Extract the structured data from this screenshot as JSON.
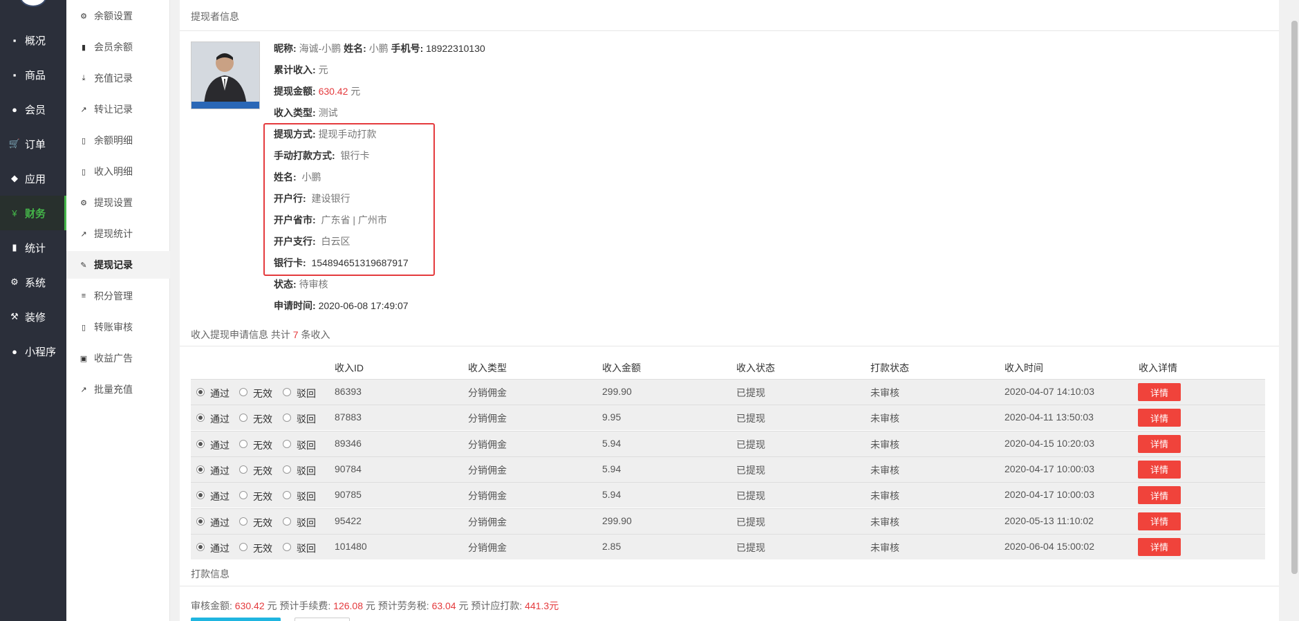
{
  "nav": {
    "items": [
      {
        "label": "概况",
        "icon": "dashboard-icon"
      },
      {
        "label": "商品",
        "icon": "box-icon"
      },
      {
        "label": "会员",
        "icon": "users-icon"
      },
      {
        "label": "订单",
        "icon": "cart-icon"
      },
      {
        "label": "应用",
        "icon": "cubes-icon"
      },
      {
        "label": "财务",
        "icon": "yen-icon",
        "active": true
      },
      {
        "label": "统计",
        "icon": "bar-chart-icon"
      },
      {
        "label": "系统",
        "icon": "gears-icon"
      },
      {
        "label": "装修",
        "icon": "gavel-icon"
      },
      {
        "label": "小程序",
        "icon": "wechat-icon"
      }
    ]
  },
  "subnav": {
    "items": [
      {
        "label": "余额设置",
        "icon": "gear-icon"
      },
      {
        "label": "会员余额",
        "icon": "book-icon"
      },
      {
        "label": "充值记录",
        "icon": "download-icon"
      },
      {
        "label": "转让记录",
        "icon": "external-link-icon"
      },
      {
        "label": "余额明细",
        "icon": "file-icon"
      },
      {
        "label": "收入明细",
        "icon": "file-icon"
      },
      {
        "label": "提现设置",
        "icon": "gear-icon"
      },
      {
        "label": "提现统计",
        "icon": "line-chart-icon"
      },
      {
        "label": "提现记录",
        "icon": "pencil-icon",
        "active": true
      },
      {
        "label": "积分管理",
        "icon": "database-icon"
      },
      {
        "label": "转账审核",
        "icon": "file-icon"
      },
      {
        "label": "收益广告",
        "icon": "image-icon"
      },
      {
        "label": "批量充值",
        "icon": "line-chart-icon"
      }
    ]
  },
  "applicant": {
    "section_title": "提现者信息",
    "nickname_label": "昵称:",
    "nickname": "海诚-小鹏",
    "name_label": "姓名:",
    "name": "小鹏",
    "phone_label": "手机号:",
    "phone": "18922310130",
    "total_income_label": "累计收入:",
    "total_income_unit": "元",
    "amount_label": "提现金额:",
    "amount": "630.42",
    "amount_unit": "元",
    "income_type_label": "收入类型:",
    "income_type": "测试",
    "method_label": "提现方式:",
    "method": "提现手动打款",
    "manual_method_label": "手动打款方式:",
    "manual_method": "银行卡",
    "holder_label": "姓名:",
    "holder": "小鹏",
    "bank_label": "开户行:",
    "bank": "建设银行",
    "province_label": "开户省市:",
    "province": "广东省 | 广州市",
    "branch_label": "开户支行:",
    "branch": "白云区",
    "card_label": "银行卡:",
    "card": "154894651319687917",
    "status_label": "状态:",
    "status": "待审核",
    "apply_time_label": "申请时间:",
    "apply_time": "2020-06-08 17:49:07"
  },
  "income": {
    "summary_prefix": "收入提现申请信息 共计",
    "count": "7",
    "summary_suffix": "条收入",
    "columns": [
      "收入ID",
      "收入类型",
      "收入金额",
      "收入状态",
      "打款状态",
      "收入时间",
      "收入详情"
    ],
    "options": [
      "通过",
      "无效",
      "驳回"
    ],
    "detail_label": "详情",
    "rows": [
      {
        "id": "86393",
        "type": "分销佣金",
        "amount": "299.90",
        "status": "已提现",
        "pay_status": "未审核",
        "time": "2020-04-07 14:10:03"
      },
      {
        "id": "87883",
        "type": "分销佣金",
        "amount": "9.95",
        "status": "已提现",
        "pay_status": "未审核",
        "time": "2020-04-11 13:50:03"
      },
      {
        "id": "89346",
        "type": "分销佣金",
        "amount": "5.94",
        "status": "已提现",
        "pay_status": "未审核",
        "time": "2020-04-15 10:20:03"
      },
      {
        "id": "90784",
        "type": "分销佣金",
        "amount": "5.94",
        "status": "已提现",
        "pay_status": "未审核",
        "time": "2020-04-17 10:00:03"
      },
      {
        "id": "90785",
        "type": "分销佣金",
        "amount": "5.94",
        "status": "已提现",
        "pay_status": "未审核",
        "time": "2020-04-17 10:00:03"
      },
      {
        "id": "95422",
        "type": "分销佣金",
        "amount": "299.90",
        "status": "已提现",
        "pay_status": "未审核",
        "time": "2020-05-13 11:10:02"
      },
      {
        "id": "101480",
        "type": "分销佣金",
        "amount": "2.85",
        "status": "已提现",
        "pay_status": "未审核",
        "time": "2020-06-04 15:00:02"
      }
    ]
  },
  "payment": {
    "section_title": "打款信息",
    "audit_label": "审核金额:",
    "audit_amount": "630.42",
    "fee_label": "元 预计手续费:",
    "fee": "126.08",
    "tax_label": "元 预计劳务税:",
    "tax": "63.04",
    "payable_label": "元 预计应打款:",
    "payable": "441.3",
    "payable_unit": "元"
  },
  "colors": {
    "accent_green": "#44b549",
    "danger_red": "#f0433b",
    "nav_bg": "#2b2f3a"
  }
}
